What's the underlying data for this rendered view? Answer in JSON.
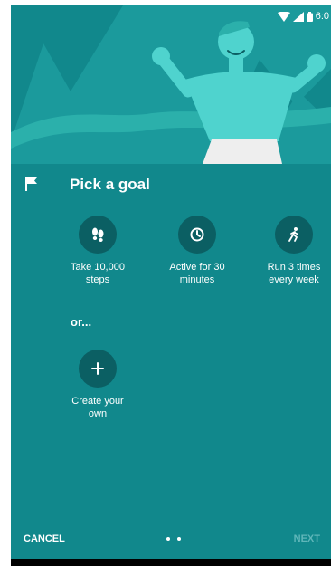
{
  "status_bar": {
    "time": "6:0"
  },
  "header": {
    "title": "Pick a goal"
  },
  "goals": [
    {
      "label": "Take 10,000\nsteps",
      "icon": "footsteps-icon"
    },
    {
      "label": "Active for 30\nminutes",
      "icon": "timer-icon"
    },
    {
      "label": "Run 3 times\nevery week",
      "icon": "runner-icon"
    }
  ],
  "or_label": "or...",
  "custom_goal": {
    "label": "Create your\nown",
    "icon": "plus-icon"
  },
  "footer": {
    "cancel_label": "CANCEL",
    "next_label": "NEXT",
    "page_count": 2
  },
  "colors": {
    "background": "#11888c",
    "icon_circle": "#0b5f63",
    "illustration": "#4fd3ce",
    "next_disabled": "#5fb6b9"
  }
}
